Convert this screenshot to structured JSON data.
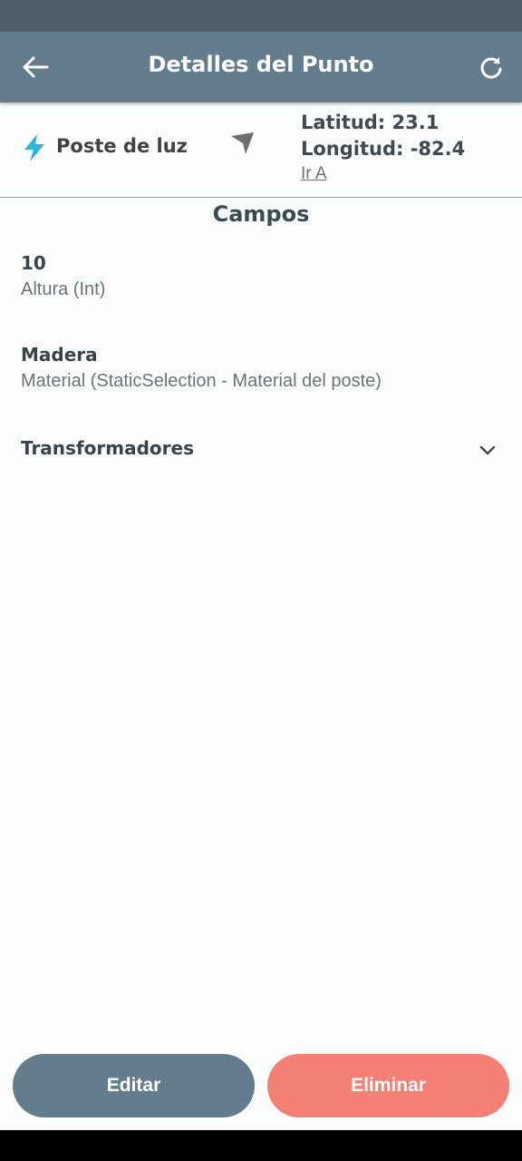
{
  "app_bar": {
    "title": "Detalles del Punto",
    "back_icon": "arrow-left-icon",
    "refresh_icon": "refresh-icon"
  },
  "point": {
    "type_icon": "lightning-bolt-icon",
    "type_icon_color": "#2bb5d8",
    "name": "Poste de luz",
    "navigate_icon": "navigation-arrow-icon",
    "latitude": "Latitud: 23.1",
    "longitude": "Longitud: -82.4",
    "go_to_label": "Ir A"
  },
  "fields_section": {
    "title": "Campos",
    "fields": [
      {
        "value": "10",
        "label": "Altura (Int)"
      },
      {
        "value": "Madera",
        "label": "Material  (StaticSelection - Material del poste)"
      }
    ],
    "expandable": {
      "label": "Transformadores",
      "icon": "chevron-down-icon"
    }
  },
  "actions": {
    "edit_label": "Editar",
    "delete_label": "Eliminar"
  },
  "colors": {
    "primary": "#637d8c",
    "danger": "#f47f75",
    "status_bar": "#4f5f69"
  }
}
